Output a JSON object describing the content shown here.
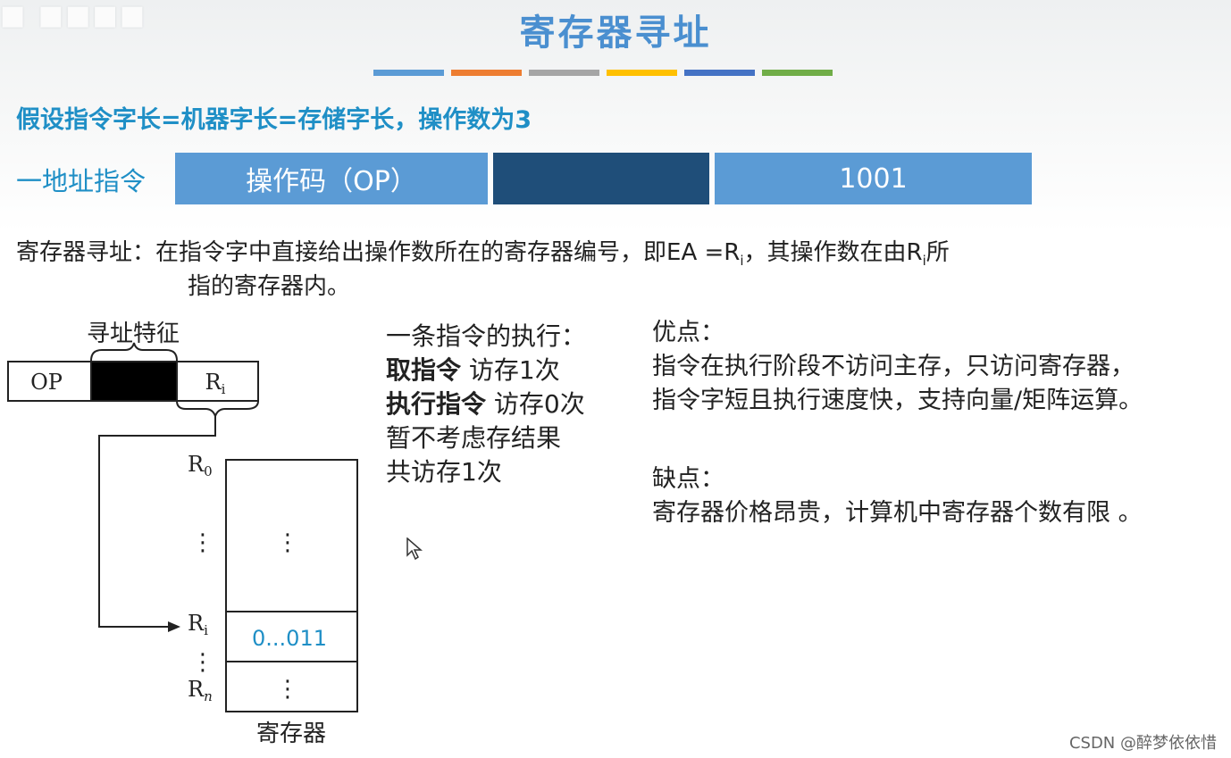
{
  "header": {
    "title": "寄存器寻址",
    "color_bars": [
      "#5b9bd5",
      "#ed7d31",
      "#a5a5a5",
      "#ffc000",
      "#4472c4",
      "#70ad47"
    ]
  },
  "assumption": "假设指令字长=机器字长=存储字长，操作数为3",
  "instruction_format": {
    "label": "一地址指令",
    "opcode": "操作码（OP）",
    "middle": "",
    "address": "1001"
  },
  "definition": {
    "term": "寄存器寻址：",
    "text_before_sub1": "在指令字中直接给出操作数所在的寄存器编号，即EA =R",
    "sub1": "i",
    "text_mid": "，其操作数在由R",
    "sub2": "i",
    "text_after": "所",
    "line2": "指的寄存器内。"
  },
  "diagram": {
    "feature_label": "寻址特征",
    "op_label": "OP",
    "ri_label": "R",
    "ri_sub": "i",
    "r0_label": "R",
    "r0_sub": "0",
    "ri_row_label": "R",
    "ri_row_sub": "i",
    "rn_label": "R",
    "rn_sub": "n",
    "ri_value": "0...011",
    "dots": "⋮",
    "caption": "寄存器"
  },
  "execution": {
    "line1": "一条指令的执行：",
    "fetch_bold": "取指令",
    "fetch_rest": " 访存1次",
    "exec_bold": "执行指令",
    "exec_rest": " 访存0次",
    "line4": "暂不考虑存结果",
    "line5": "共访存1次"
  },
  "advantages": {
    "heading": "优点：",
    "line1": "指令在执行阶段不访问主存，只访问寄存器，",
    "line2": "指令字短且执行速度快，支持向量/矩阵运算。"
  },
  "disadvantages": {
    "heading": "缺点：",
    "line1": "寄存器价格昂贵，计算机中寄存器个数有限 。"
  },
  "watermark": "CSDN @醉梦依依惜",
  "icons": {
    "cursor": "mouse-pointer-icon"
  }
}
